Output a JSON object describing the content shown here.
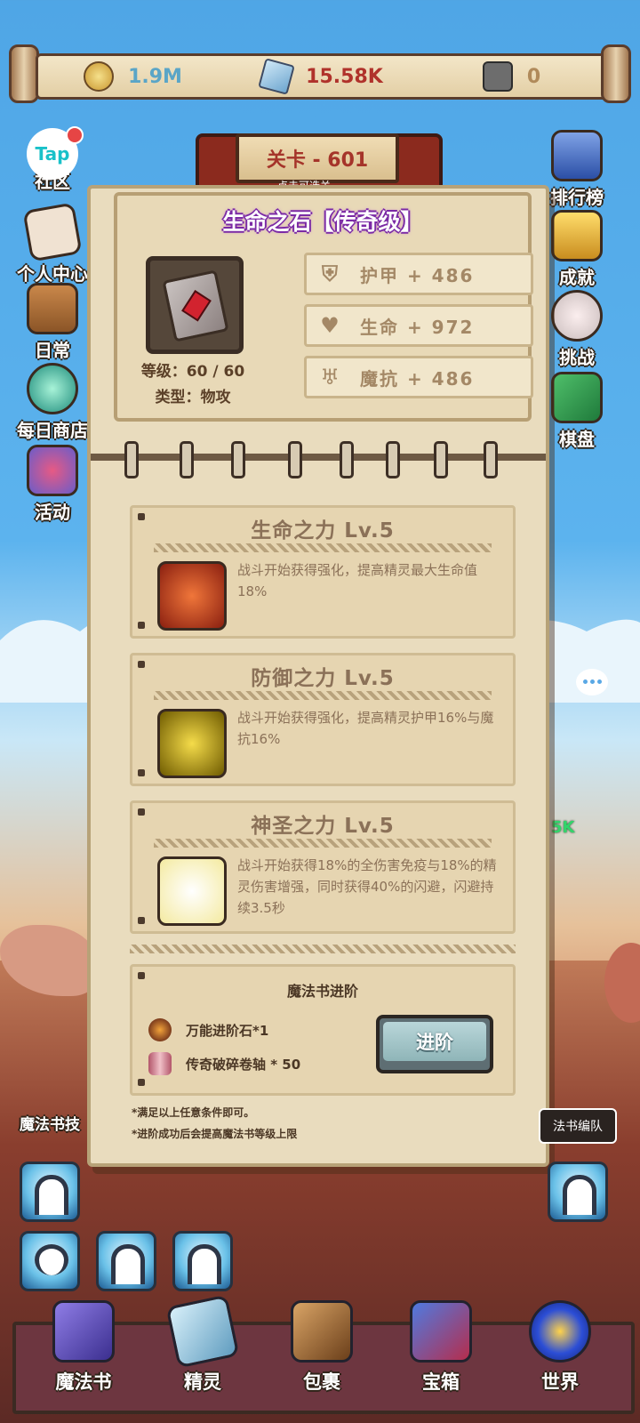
{
  "resources": {
    "gold": {
      "value": "1.9M",
      "icon": "coin-icon",
      "color": "#5aa5c7"
    },
    "crystal": {
      "value": "15.58K",
      "icon": "crystal-icon",
      "color": "#b0322b"
    },
    "rune": {
      "value": "0",
      "icon": "rune-stone-icon",
      "color": "#b08a5a"
    }
  },
  "level": {
    "title": "关卡 - 601",
    "subtitle": "点击可选关"
  },
  "left_menu": [
    {
      "label": "社区",
      "icon": "tap-community-icon",
      "badge": true
    },
    {
      "label": "个人中心",
      "icon": "letter-icon"
    },
    {
      "label": "日常",
      "icon": "barrel-icon"
    },
    {
      "label": "每日商店",
      "icon": "crystal-ball-icon"
    },
    {
      "label": "活动",
      "icon": "cup-icon"
    }
  ],
  "right_menu": [
    {
      "label": "排行榜",
      "icon": "trophy-cup-icon"
    },
    {
      "label": "成就",
      "icon": "gold-trophy-icon"
    },
    {
      "label": "挑战",
      "icon": "skull-icon"
    },
    {
      "label": "棋盘",
      "icon": "chessboard-icon"
    }
  ],
  "panel": {
    "title": "生命之石【传奇级】",
    "book_icon": "magic-book-icon",
    "level_text": "等级：60 / 60",
    "type_text": "类型：物攻",
    "stats": [
      {
        "icon": "shield-icon",
        "text": "护甲 + 486"
      },
      {
        "icon": "heart-icon",
        "text": "生命 + 972"
      },
      {
        "icon": "magic-resist-icon",
        "text": "魔抗 + 486"
      }
    ],
    "skills": [
      {
        "title": "生命之力 Lv.5",
        "desc": "战斗开始获得强化，提高精灵最大生命值18%",
        "icon": "life-power-icon",
        "color": "#c9371e"
      },
      {
        "title": "防御之力 Lv.5",
        "desc": "战斗开始获得强化，提高精灵护甲16%与魔抗16%",
        "icon": "defense-power-icon",
        "color": "#d6b200"
      },
      {
        "title": "神圣之力 Lv.5",
        "desc": "战斗开始获得18%的全伤害免疫与18%的精灵伤害增强，同时获得40%的闪避，闪避持续3.5秒",
        "icon": "holy-power-icon",
        "color": "#fff6c5"
      }
    ],
    "advance": {
      "title": "魔法书进阶",
      "items": [
        {
          "icon": "advance-stone-icon",
          "text": "万能进阶石*1"
        },
        {
          "icon": "scroll-icon",
          "text": "传奇破碎卷轴 * 50"
        }
      ],
      "button": "进阶",
      "notes": [
        "*满足以上任意条件即可。",
        "*进阶成功后会提高魔法书等级上限"
      ]
    }
  },
  "side_extra": {
    "green_text": "5K"
  },
  "bottom": {
    "skill_label": "魔法书技",
    "team_button": "法书编队"
  },
  "nav": [
    {
      "label": "魔法书",
      "icon": "spellbook-nav-icon",
      "color": "#6b5cc9"
    },
    {
      "label": "精灵",
      "icon": "sprite-nav-icon",
      "color": "#8fc4dd"
    },
    {
      "label": "包裹",
      "icon": "bag-nav-icon",
      "color": "#9a6a3a"
    },
    {
      "label": "宝箱",
      "icon": "chest-nav-icon",
      "color": "#7b3a8f"
    },
    {
      "label": "世界",
      "icon": "world-nav-icon",
      "color": "#3b5dd4"
    }
  ]
}
